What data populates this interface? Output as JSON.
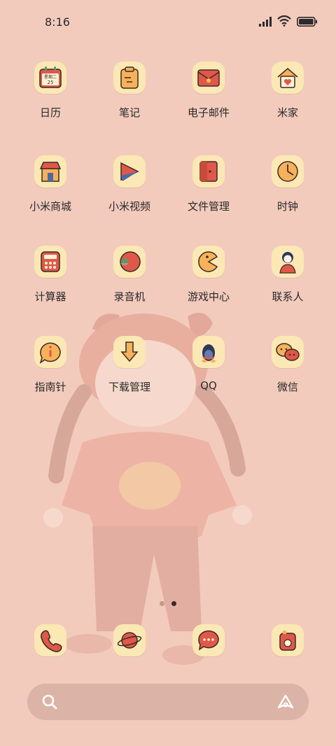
{
  "status": {
    "time": "8:16"
  },
  "apps": [
    {
      "label": "日历",
      "icon": "calendar-icon",
      "icon_text": "星期二",
      "icon_num": "25"
    },
    {
      "label": "笔记",
      "icon": "notes-icon"
    },
    {
      "label": "电子邮件",
      "icon": "mail-icon"
    },
    {
      "label": "米家",
      "icon": "home-icon"
    },
    {
      "label": "小米商城",
      "icon": "store-icon"
    },
    {
      "label": "小米视频",
      "icon": "video-icon"
    },
    {
      "label": "文件管理",
      "icon": "folder-icon"
    },
    {
      "label": "时钟",
      "icon": "clock-icon"
    },
    {
      "label": "计算器",
      "icon": "calculator-icon"
    },
    {
      "label": "录音机",
      "icon": "recorder-icon"
    },
    {
      "label": "游戏中心",
      "icon": "game-icon"
    },
    {
      "label": "联系人",
      "icon": "contacts-icon"
    },
    {
      "label": "指南针",
      "icon": "compass-icon"
    },
    {
      "label": "下载管理",
      "icon": "download-icon"
    },
    {
      "label": "QQ",
      "icon": "qq-icon"
    },
    {
      "label": "微信",
      "icon": "wechat-icon"
    }
  ],
  "dock": [
    "phone-icon",
    "browser-icon",
    "messages-icon",
    "camera-icon"
  ],
  "page_indicator": {
    "count": 2,
    "active": 2
  },
  "colors": {
    "background": "#f2cbbd",
    "tile": "#fbe8b4",
    "accent": "#e0584a"
  }
}
